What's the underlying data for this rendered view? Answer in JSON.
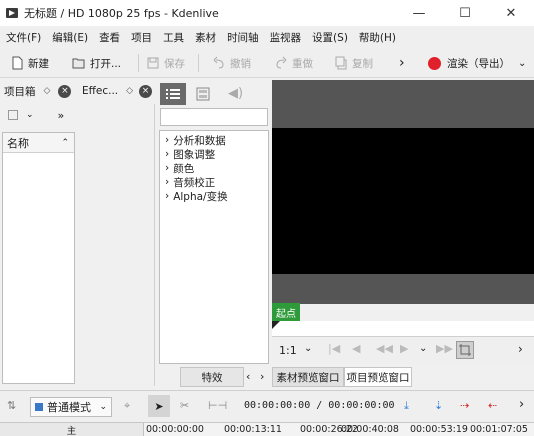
{
  "window": {
    "title": "无标题 / HD 1080p 25 fps - Kdenlive",
    "minimize": "—",
    "maximize": "☐",
    "close": "✕"
  },
  "menu": [
    "文件(F)",
    "编辑(E)",
    "查看",
    "项目",
    "工具",
    "素材",
    "时间轴",
    "监视器",
    "设置(S)",
    "帮助(H)"
  ],
  "toolbar": {
    "new_label": "新建",
    "open_label": "打开...",
    "save_label": "保存",
    "undo_label": "撤销",
    "redo_label": "重做",
    "copy_label": "复制",
    "render_label": "渲染（导出）"
  },
  "project_bin": {
    "title": "项目箱",
    "column_name": "名称"
  },
  "effects_dock": {
    "title": "Effec..."
  },
  "effects_tree": [
    "分析和数据",
    "图象调整",
    "颜色",
    "音频校正",
    "Alpha/变换"
  ],
  "effects_tab": "特效",
  "monitor": {
    "in_point": "起点",
    "zoom": "1:1",
    "tab_clip": "素材预览窗口",
    "tab_project": "项目预览窗口"
  },
  "timeline": {
    "mode": "普通模式",
    "timecode": "00:00:00:00 / 00:00:00:00",
    "track_label": "主",
    "ruler_ticks": [
      "00:00:00:00",
      "00:00:13:11",
      "00:00:26:22",
      "00:00:40:08",
      "00:00:53:19",
      "00:01:07:05"
    ]
  },
  "colors": {
    "accent_green": "#2e9a3a",
    "render_red": "#e0202a",
    "monitor_dark": "#555555",
    "toolbar_bg": "#efefef"
  }
}
